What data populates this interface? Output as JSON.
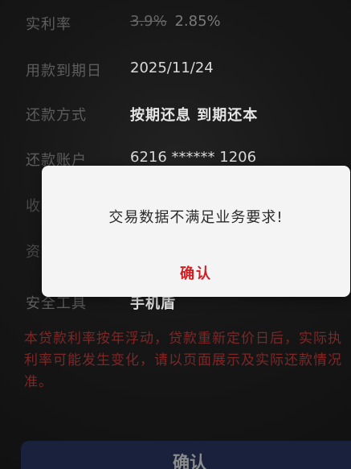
{
  "background": {
    "rows": [
      {
        "label": "实利率",
        "value_old": "3.9%",
        "value_new": "2.85%"
      },
      {
        "label": "用款到期日",
        "value": "2025/11/24"
      },
      {
        "label": "还款方式",
        "value": "按期还息 到期还本"
      },
      {
        "label": "还款账户",
        "value": "6216 ****** 1206"
      },
      {
        "label": "收"
      },
      {
        "label": "资"
      },
      {
        "label": "安全工具",
        "value": "手机盾"
      }
    ],
    "notice_lines": [
      "本贷款利率按年浮动，贷款重新定价日后，实际执",
      "利率可能发生变化，请以页面展示及实际还款情况",
      "准。"
    ],
    "bottom_button_label": "确认"
  },
  "dialog": {
    "message": "交易数据不满足业务要求!",
    "confirm_label": "确认"
  },
  "colors": {
    "dialog_background": "#f4f4f4",
    "confirm_red": "#d11d22",
    "notice_red": "#7d2727",
    "bottom_button_navy": "#19213c"
  }
}
